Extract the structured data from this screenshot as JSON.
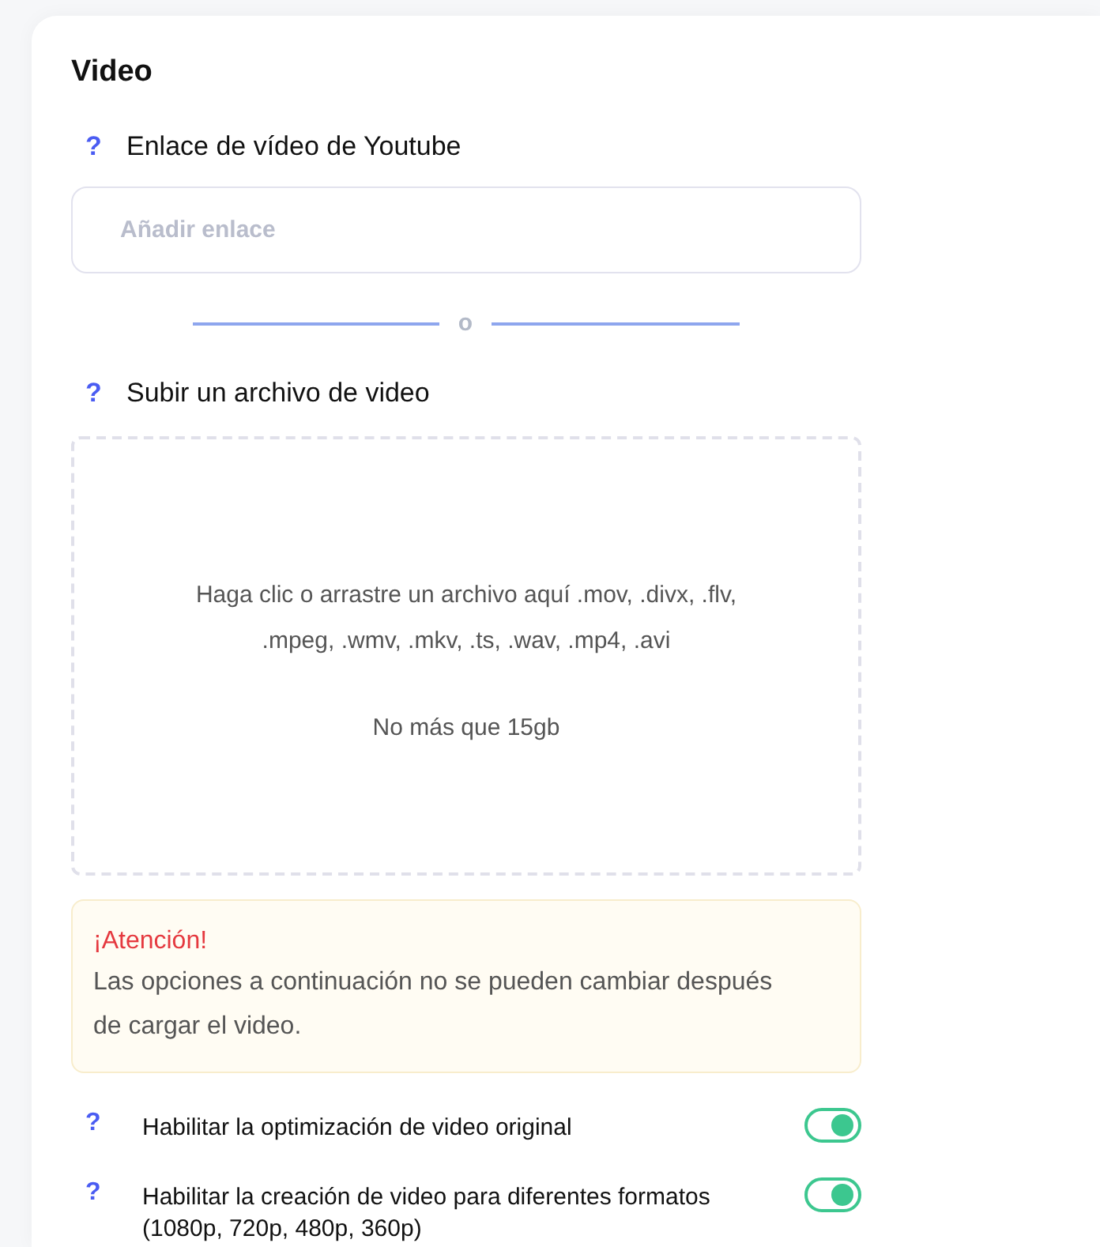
{
  "section": {
    "title": "Video"
  },
  "youtube_link": {
    "help": "?",
    "label": "Enlace de vídeo de Youtube",
    "placeholder": "Añadir enlace"
  },
  "divider": {
    "text": "o"
  },
  "upload": {
    "help": "?",
    "label": "Subir un archivo de video",
    "instructions": "Haga clic o arrastre un archivo aquí .mov, .divx, .flv, .mpeg, .wmv, .mkv, .ts, .wav, .mp4, .avi",
    "limit": "No más que 15gb"
  },
  "notice": {
    "title": "¡Atención!",
    "message": "Las opciones a continuación no se pueden cambiar después de cargar el video."
  },
  "options": [
    {
      "help": "?",
      "label": "Habilitar la optimización de video original",
      "on": true
    },
    {
      "help": "?",
      "label": "Habilitar la creación de video para diferentes formatos (1080p, 720p, 480p, 360p)",
      "on": true
    }
  ]
}
